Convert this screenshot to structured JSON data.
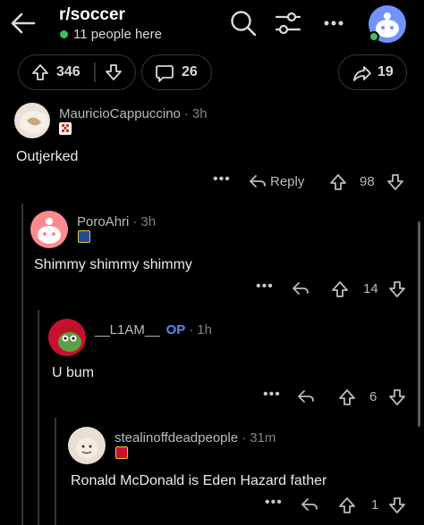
{
  "header": {
    "subreddit": "r/soccer",
    "online_count": "11 people here",
    "icons": [
      "back-arrow-icon",
      "search-icon",
      "filter-sort-icon",
      "more-icon",
      "user-avatar-icon"
    ]
  },
  "post_actions": {
    "upvotes": "346",
    "comments": "26",
    "shares": "19"
  },
  "comments": [
    {
      "user": "MauricioCappuccino",
      "time": "3h",
      "body": "Outjerked",
      "reply_label": "Reply",
      "score": "98",
      "op": ""
    },
    {
      "user": "PoroAhri",
      "time": "3h",
      "body": "Shimmy shimmy shimmy",
      "score": "14",
      "op": ""
    },
    {
      "user": "__L1AM__",
      "time": "1h",
      "body": "U bum",
      "score": "6",
      "op": "OP"
    },
    {
      "user": "stealinoffdeadpeople",
      "time": "31m",
      "body": "Ronald McDonald is Eden Hazard father",
      "score": "1",
      "op": ""
    }
  ],
  "colors": {
    "background": "#000000",
    "text": "#d7dadc",
    "muted": "#818384",
    "online_green": "#3fbf5f",
    "op_blue": "#4f8cf7",
    "border": "#343536"
  }
}
